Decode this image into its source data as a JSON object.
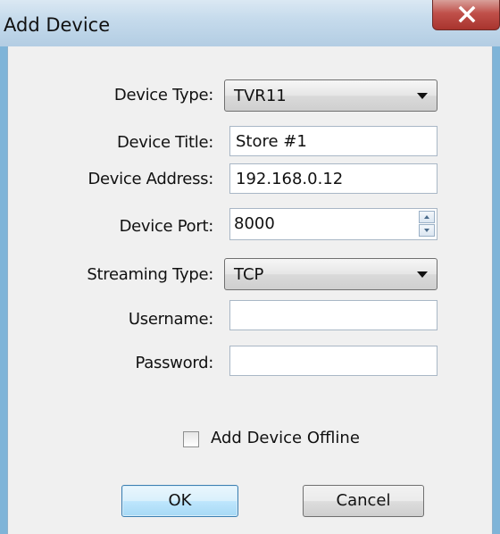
{
  "window": {
    "title": "Add Device"
  },
  "form": {
    "device_type": {
      "label": "Device Type:",
      "value": "TVR11"
    },
    "device_title": {
      "label": "Device Title:",
      "value": "Store #1"
    },
    "device_address": {
      "label": "Device Address:",
      "value": "192.168.0.12"
    },
    "device_port": {
      "label": "Device Port:",
      "value": "8000"
    },
    "streaming_type": {
      "label": "Streaming Type:",
      "value": "TCP"
    },
    "username": {
      "label": "Username:",
      "value": ""
    },
    "password": {
      "label": "Password:",
      "value": ""
    },
    "offline": {
      "label": "Add Device Offline",
      "checked": false
    }
  },
  "buttons": {
    "ok": "OK",
    "cancel": "Cancel"
  },
  "colors": {
    "title_bar": "#c6dbec",
    "close_button": "#c0504a",
    "dialog_bg": "#f0f0f0",
    "ok_focus": "#3c7fb1"
  },
  "icons": {
    "close": "close-icon",
    "dropdown": "chevron-down-icon",
    "spin_up": "spin-up-icon",
    "spin_down": "spin-down-icon"
  }
}
